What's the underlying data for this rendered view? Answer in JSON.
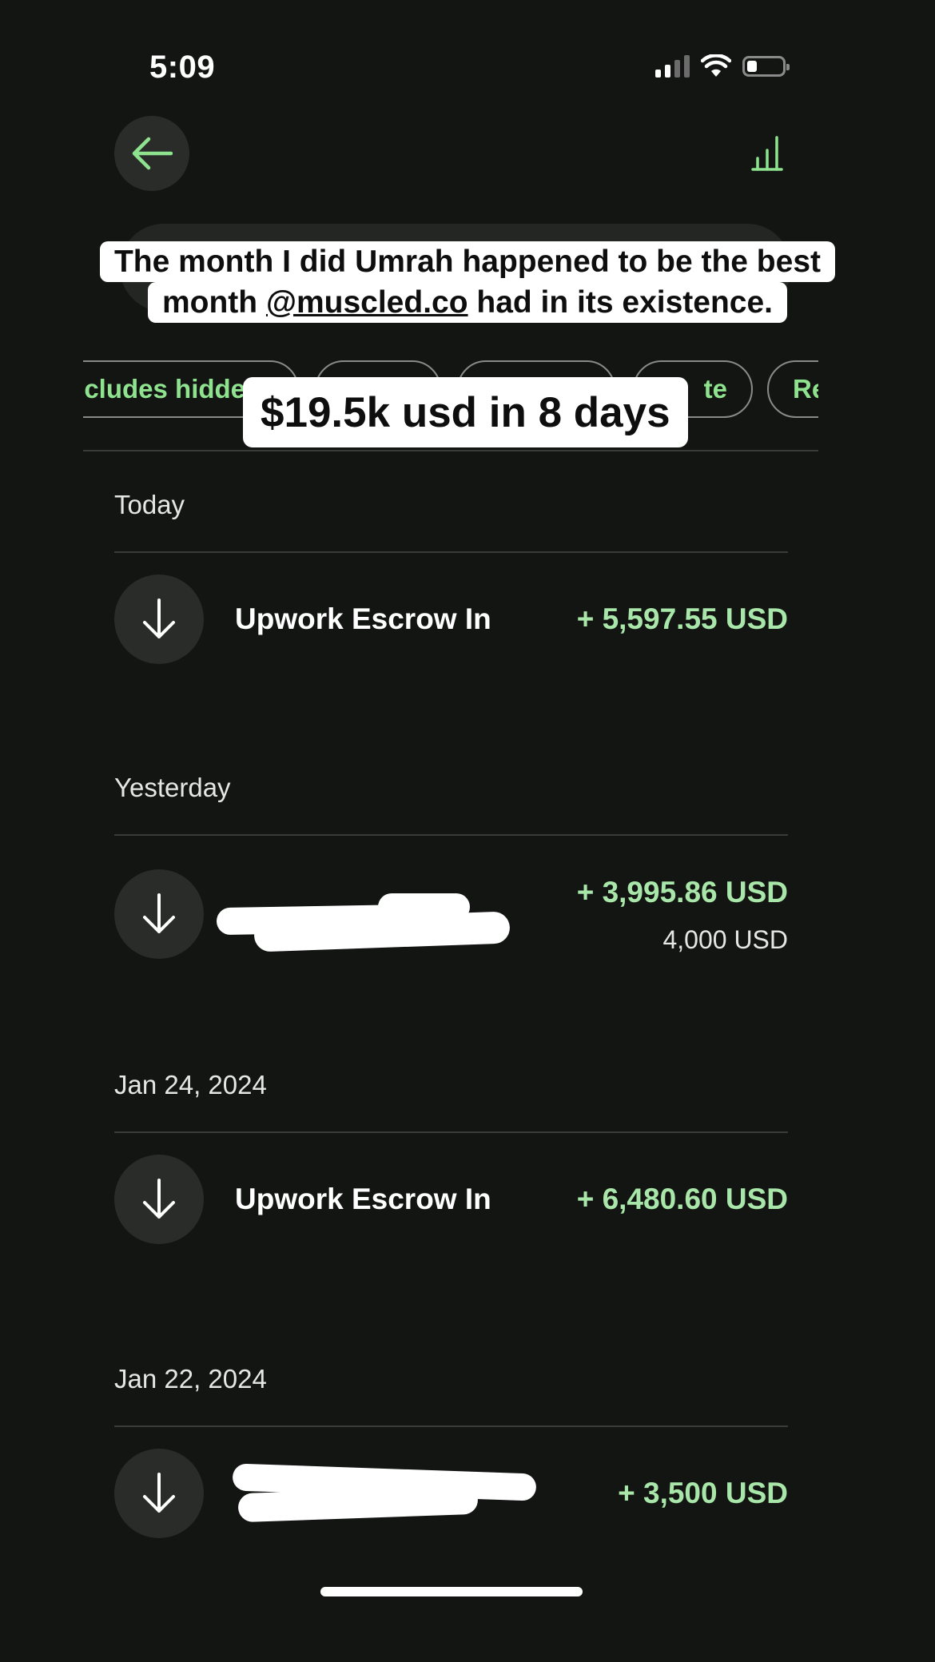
{
  "status_bar": {
    "time": "5:09"
  },
  "icons": {
    "back": "arrow-left-icon",
    "chart": "bar-chart-icon",
    "transaction": "arrow-down-icon"
  },
  "colors": {
    "accent_green": "#8fe38f",
    "amount_green": "#a9e6a9",
    "background": "#131513"
  },
  "filters": [
    {
      "label": "Includes hidden"
    },
    {
      "label": ""
    },
    {
      "label": ""
    },
    {
      "label": "te"
    },
    {
      "label": "Re"
    }
  ],
  "overlay": {
    "caption_line1": "The month I did Umrah happened to be the best",
    "caption_line2_pre": "month ",
    "caption_line2_link": "@muscled.co",
    "caption_line2_post": " had in its existence.",
    "headline": "$19.5k usd in 8 days"
  },
  "sections": [
    {
      "date": "Today",
      "transaction": {
        "name": "Upwork Escrow In",
        "amount": "+ 5,597.55 USD",
        "sub": ""
      }
    },
    {
      "date": "Yesterday",
      "transaction": {
        "name": "",
        "amount": "+ 3,995.86 USD",
        "sub": "4,000 USD"
      }
    },
    {
      "date": "Jan 24, 2024",
      "transaction": {
        "name": "Upwork Escrow In",
        "amount": "+ 6,480.60 USD",
        "sub": ""
      }
    },
    {
      "date": "Jan 22, 2024",
      "transaction": {
        "name": "",
        "amount": "+ 3,500 USD",
        "sub": ""
      }
    }
  ]
}
